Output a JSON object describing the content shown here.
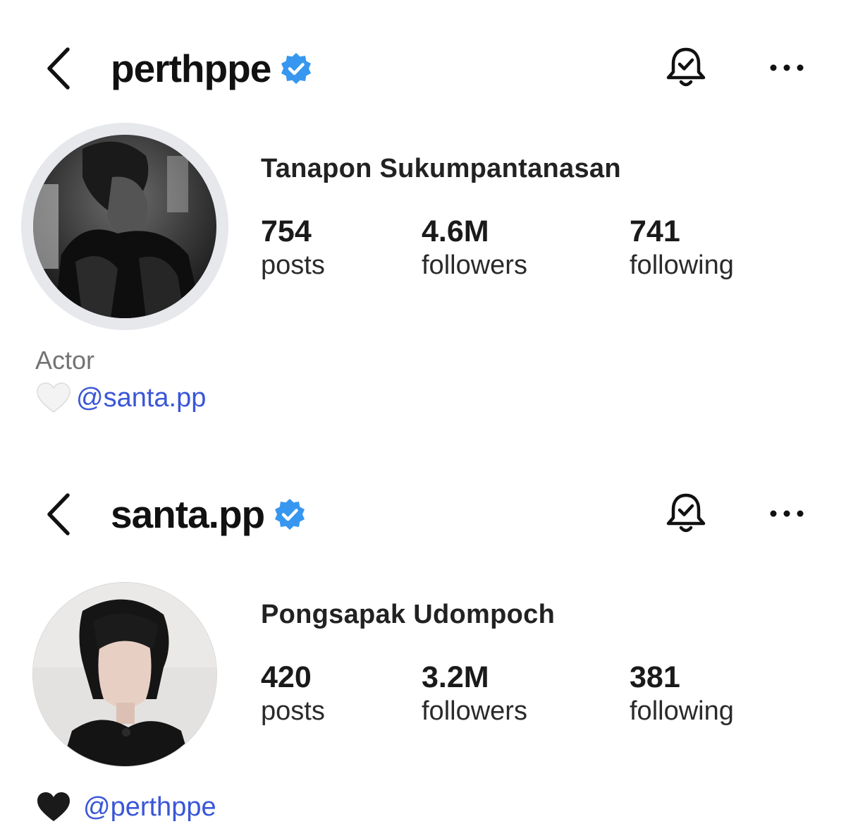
{
  "profiles": [
    {
      "username": "perthppe",
      "full_name": "Tanapon Sukumpantanasan",
      "stats": {
        "posts_count": "754",
        "posts_label": "posts",
        "followers_count": "4.6M",
        "followers_label": "followers",
        "following_count": "741",
        "following_label": "following"
      },
      "bio": {
        "category": "Actor",
        "heart": "🤍",
        "mention": "@santa.pp"
      }
    },
    {
      "username": "santa.pp",
      "full_name": "Pongsapak Udompoch",
      "stats": {
        "posts_count": "420",
        "posts_label": "posts",
        "followers_count": "3.2M",
        "followers_label": "followers",
        "following_count": "381",
        "following_label": "following"
      },
      "bio": {
        "heart": "🖤",
        "mention": "@perthppe"
      }
    }
  ],
  "icons": {
    "back": "chevron-left-icon",
    "verified": "verified-badge-icon",
    "notifications": "bell-check-icon",
    "more": "more-horizontal-icon"
  },
  "colors": {
    "verified_blue": "#3797f0",
    "mention_blue": "#3a57d8",
    "category_gray": "#737373"
  }
}
